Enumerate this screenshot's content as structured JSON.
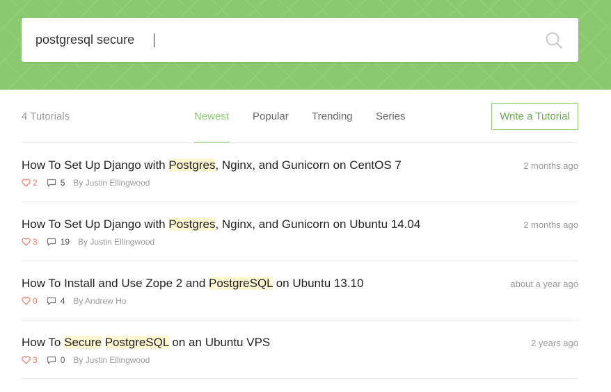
{
  "search": {
    "value": "postgresql secure",
    "icon": "search-icon"
  },
  "toolbar": {
    "count": "4 Tutorials",
    "tabs": [
      {
        "label": "Newest",
        "active": true
      },
      {
        "label": "Popular",
        "active": false
      },
      {
        "label": "Trending",
        "active": false
      },
      {
        "label": "Series",
        "active": false
      }
    ],
    "write_button": "Write a Tutorial"
  },
  "tutorials": [
    {
      "title_parts": [
        {
          "text": "How To Set Up Django with ",
          "highlight": false
        },
        {
          "text": "Postgres",
          "highlight": true
        },
        {
          "text": ", Nginx, and Gunicorn on CentOS 7",
          "highlight": false
        }
      ],
      "likes": "2",
      "comments": "5",
      "author": "By Justin Ellingwood",
      "time": "2 months ago"
    },
    {
      "title_parts": [
        {
          "text": "How To Set Up Django with ",
          "highlight": false
        },
        {
          "text": "Postgres",
          "highlight": true
        },
        {
          "text": ", Nginx, and Gunicorn on Ubuntu 14.04",
          "highlight": false
        }
      ],
      "likes": "3",
      "comments": "19",
      "author": "By Justin Ellingwood",
      "time": "2 months ago"
    },
    {
      "title_parts": [
        {
          "text": "How To Install and Use Zope 2 and ",
          "highlight": false
        },
        {
          "text": "PostgreSQL",
          "highlight": true
        },
        {
          "text": " on Ubuntu 13.10",
          "highlight": false
        }
      ],
      "likes": "0",
      "comments": "4",
      "author": "By Andrew Ho",
      "time": "about a year ago"
    },
    {
      "title_parts": [
        {
          "text": "How To ",
          "highlight": false
        },
        {
          "text": "Secure",
          "highlight": true
        },
        {
          "text": " ",
          "highlight": false
        },
        {
          "text": "PostgreSQL",
          "highlight": true
        },
        {
          "text": " on an Ubuntu VPS",
          "highlight": false
        }
      ],
      "likes": "3",
      "comments": "0",
      "author": "By Justin Ellingwood",
      "time": "2 years ago"
    }
  ],
  "colors": {
    "brand_green": "#8ac96f",
    "highlight": "#fdf6d3",
    "heart": "#e07a6a"
  }
}
